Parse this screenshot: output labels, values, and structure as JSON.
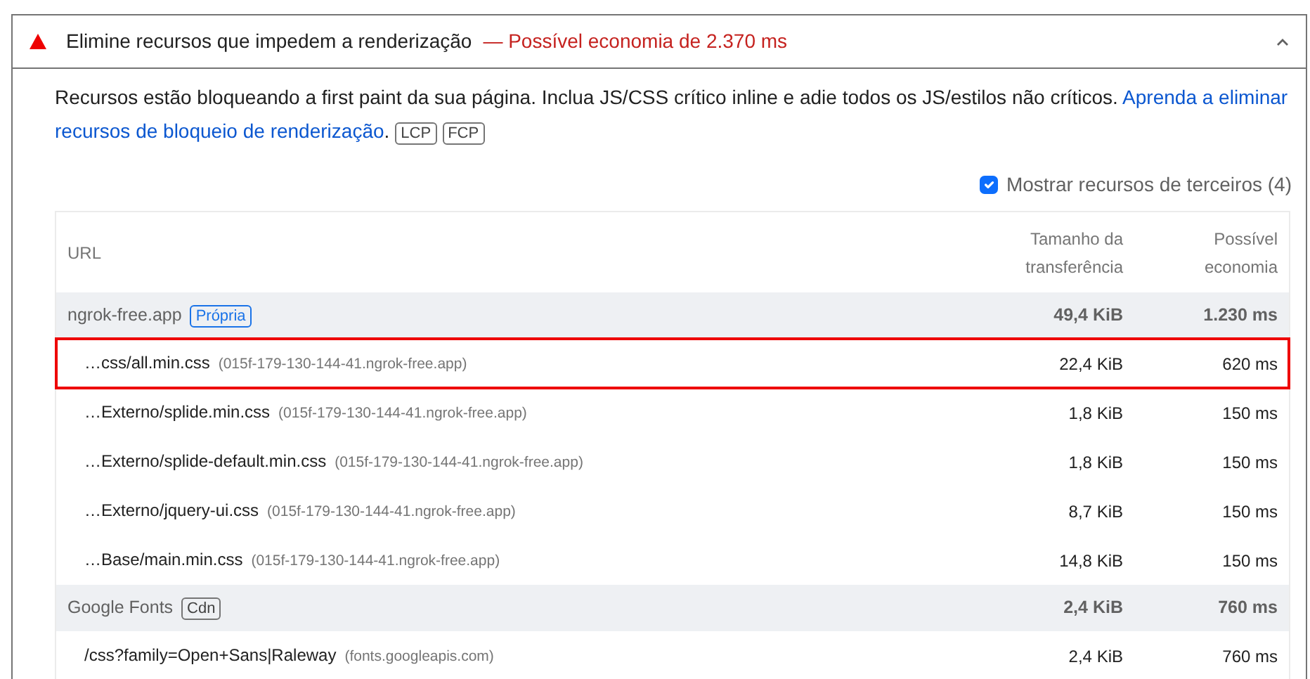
{
  "audit": {
    "title": "Elimine recursos que impedem a renderização",
    "savings": "— Possível economia de 2.370 ms",
    "expanded": true
  },
  "description": {
    "text": "Recursos estão bloqueando a first paint da sua página. Inclua JS/CSS crítico inline e adie todos os JS/estilos não críticos.",
    "link": [
      "Aprenda a eliminar",
      "recursos de bloqueio de renderização"
    ],
    "after": ".",
    "tags": [
      "LCP",
      "FCP"
    ]
  },
  "third_party_filter": {
    "label": "Mostrar recursos de terceiros (4)",
    "checked": true
  },
  "table": {
    "columns": [
      "URL",
      "Tamanho da transferência",
      "Possível economia"
    ],
    "groups": [
      {
        "name": "ngrok-free.app",
        "badge": "Própria",
        "kind": "first-party",
        "size": "49,4 KiB",
        "savings": "1.230 ms",
        "rows": [
          {
            "url": "…css/all.min.css",
            "host": "(015f-179-130-144-41.ngrok-free.app)",
            "size": "22,4 KiB",
            "savings": "620 ms",
            "highlighted": true
          },
          {
            "url": "…Externo/splide.min.css",
            "host": "(015f-179-130-144-41.ngrok-free.app)",
            "size": "1,8 KiB",
            "savings": "150 ms",
            "highlighted": false
          },
          {
            "url": "…Externo/splide-default.min.css",
            "host": "(015f-179-130-144-41.ngrok-free.app)",
            "size": "1,8 KiB",
            "savings": "150 ms",
            "highlighted": false
          },
          {
            "url": "…Externo/jquery-ui.css",
            "host": "(015f-179-130-144-41.ngrok-free.app)",
            "size": "8,7 KiB",
            "savings": "150 ms",
            "highlighted": false
          },
          {
            "url": "…Base/main.min.css",
            "host": "(015f-179-130-144-41.ngrok-free.app)",
            "size": "14,8 KiB",
            "savings": "150 ms",
            "highlighted": false
          }
        ]
      },
      {
        "name": "Google Fonts",
        "badge": "Cdn",
        "kind": "third-party",
        "size": "2,4 KiB",
        "savings": "760 ms",
        "rows": [
          {
            "url": "/css?family=Open+Sans|Raleway",
            "host": "(fonts.googleapis.com)",
            "size": "2,4 KiB",
            "savings": "760 ms",
            "highlighted": false
          }
        ]
      }
    ]
  }
}
